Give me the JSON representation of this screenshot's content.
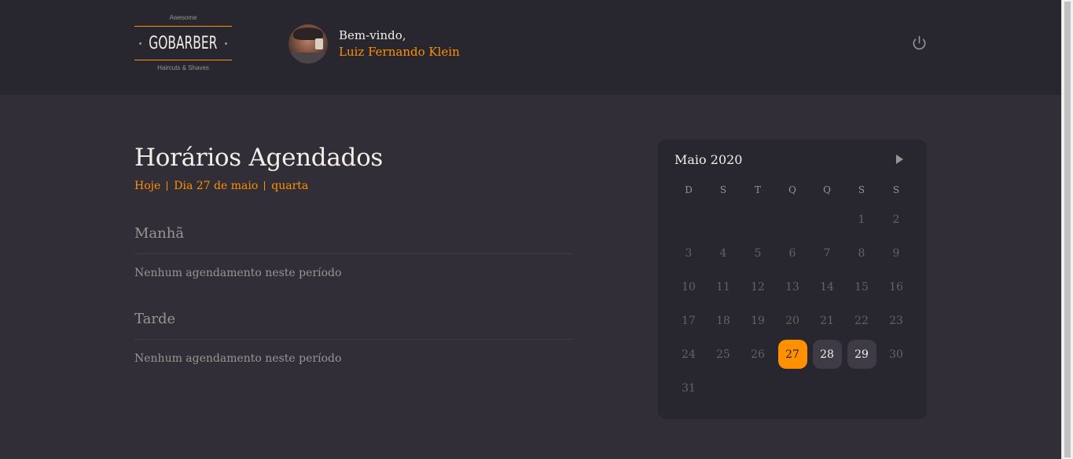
{
  "logo": {
    "top_text": "Awesome",
    "brand": "GOBARBER",
    "bottom_text": "Haircuts & Shaves"
  },
  "profile": {
    "welcome": "Bem-vindo,",
    "name": "Luiz Fernando Klein"
  },
  "icons": {
    "power": "power-icon",
    "next_month": "chevron-right-icon"
  },
  "colors": {
    "accent": "#ff9000",
    "header_bg": "#28262e",
    "page_bg": "#312e38",
    "muted_text": "#999591"
  },
  "schedule": {
    "title": "Horários Agendados",
    "date_parts": [
      "Hoje",
      "Dia 27 de maio",
      "quarta"
    ],
    "morning": {
      "title": "Manhã",
      "empty": "Nenhum agendamento neste período"
    },
    "afternoon": {
      "title": "Tarde",
      "empty": "Nenhum agendamento neste período"
    }
  },
  "calendar": {
    "month_label": "Maio 2020",
    "weekdays": [
      "D",
      "S",
      "T",
      "Q",
      "Q",
      "S",
      "S"
    ],
    "weeks": [
      [
        "",
        "",
        "",
        "",
        "",
        "1",
        "2"
      ],
      [
        "3",
        "4",
        "5",
        "6",
        "7",
        "8",
        "9"
      ],
      [
        "10",
        "11",
        "12",
        "13",
        "14",
        "15",
        "16"
      ],
      [
        "17",
        "18",
        "19",
        "20",
        "21",
        "22",
        "23"
      ],
      [
        "24",
        "25",
        "26",
        "27",
        "28",
        "29",
        "30"
      ],
      [
        "31",
        "",
        "",
        "",
        "",
        "",
        ""
      ]
    ],
    "selected_day": "27",
    "available_days": [
      "28",
      "29"
    ]
  }
}
